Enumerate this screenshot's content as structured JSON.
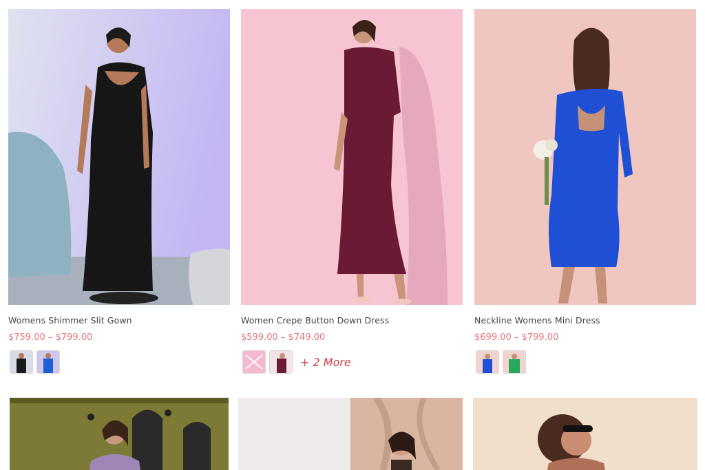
{
  "products": [
    {
      "title": "Womens Shimmer Slit Gown",
      "price": "$759.00 – $799.00",
      "swatch_colors": [
        "#1a1a1a",
        "#1e5fd3"
      ],
      "more": ""
    },
    {
      "title": "Women Crepe Button Down Dress",
      "price": "$599.00 – $749.00",
      "swatch_colors": [
        "#f6b7cf",
        "#6b1a35"
      ],
      "more": "+ 2 More"
    },
    {
      "title": "Neckline Womens Mini Dress",
      "price": "$699.00 – $799.00",
      "swatch_colors": [
        "#1e4fd6",
        "#27a85a"
      ],
      "more": ""
    }
  ],
  "colors": {
    "price": "#e8747e",
    "more_link": "#d63e4c",
    "title": "#444444"
  }
}
